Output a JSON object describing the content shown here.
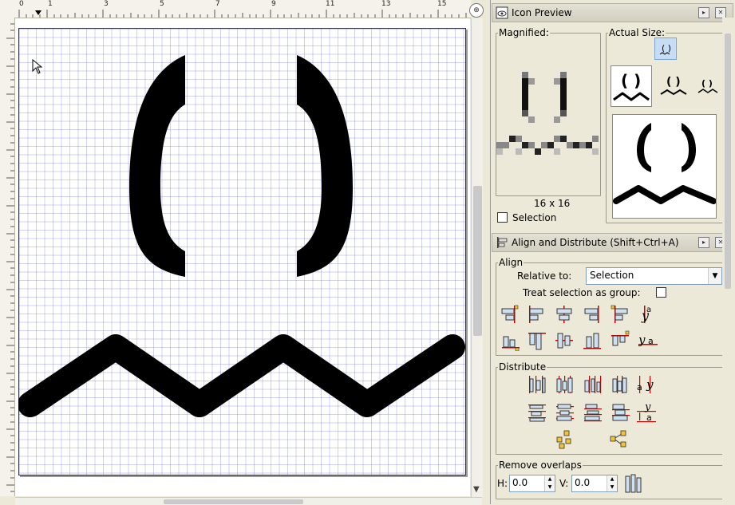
{
  "ruler": {
    "labels": [
      "0",
      "1",
      "3",
      "5",
      "7",
      "9",
      "11",
      "13",
      "15"
    ]
  },
  "canvas": {
    "bracket_color": "#000000",
    "grid_color": "#7878dc"
  },
  "icon_preview": {
    "title": "Icon Preview",
    "magnified_label": "Magnified:",
    "actual_size_label": "Actual Size:",
    "size_text": "16 x 16",
    "selection_label": "Selection"
  },
  "align_distribute": {
    "title": "Align and Distribute (Shift+Ctrl+A)",
    "align_label": "Align",
    "relative_to_label": "Relative to:",
    "relative_to_value": "Selection",
    "treat_group_label": "Treat selection as group:",
    "distribute_label": "Distribute",
    "remove_overlaps_label": "Remove overlaps",
    "h_label": "H:",
    "h_value": "0.0",
    "v_label": "V:",
    "v_value": "0.0"
  }
}
